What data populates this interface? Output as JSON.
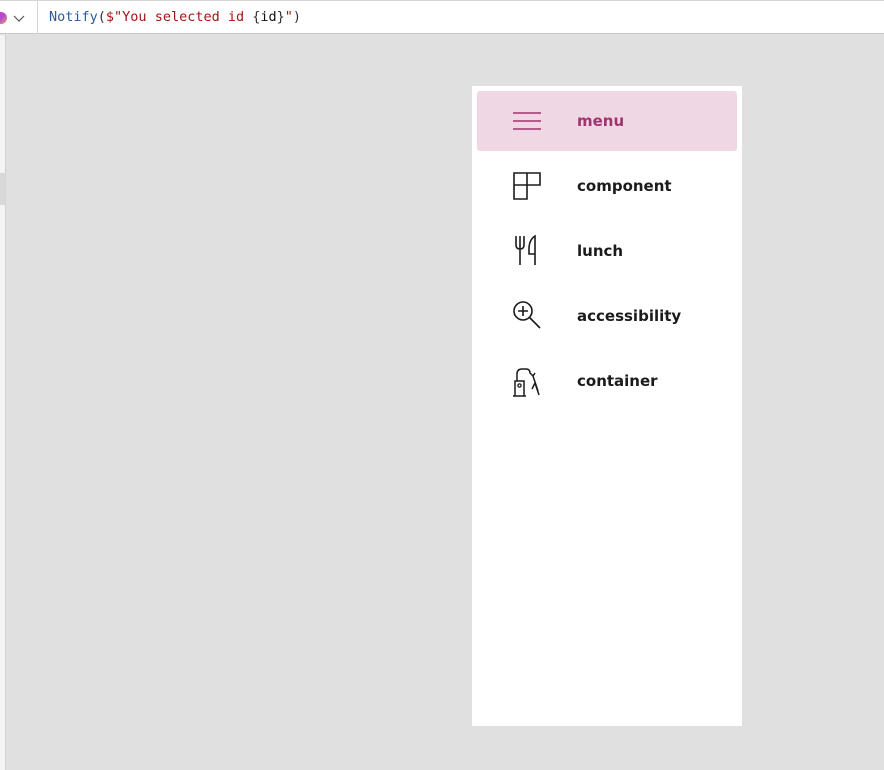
{
  "formula_bar": {
    "tokens": {
      "fn": "Notify",
      "open": "(",
      "str_start": "$\"You selected id ",
      "brace_open": "{",
      "ident": "id",
      "brace_close": "}",
      "str_end": "\"",
      "close": ")"
    },
    "icons": [
      "copilot-icon",
      "chevron-down-icon"
    ]
  },
  "nav": {
    "selected_index": 0,
    "accent_color": "#a03470",
    "selected_bg": "#efd7e4",
    "items": [
      {
        "label": "menu",
        "icon": "hamburger-menu-icon",
        "selected": true
      },
      {
        "label": "component",
        "icon": "component-grid-icon",
        "selected": false
      },
      {
        "label": "lunch",
        "icon": "fork-knife-icon",
        "selected": false
      },
      {
        "label": "accessibility",
        "icon": "zoom-in-icon",
        "selected": false
      },
      {
        "label": "container",
        "icon": "robotic-arm-icon",
        "selected": false
      }
    ]
  }
}
